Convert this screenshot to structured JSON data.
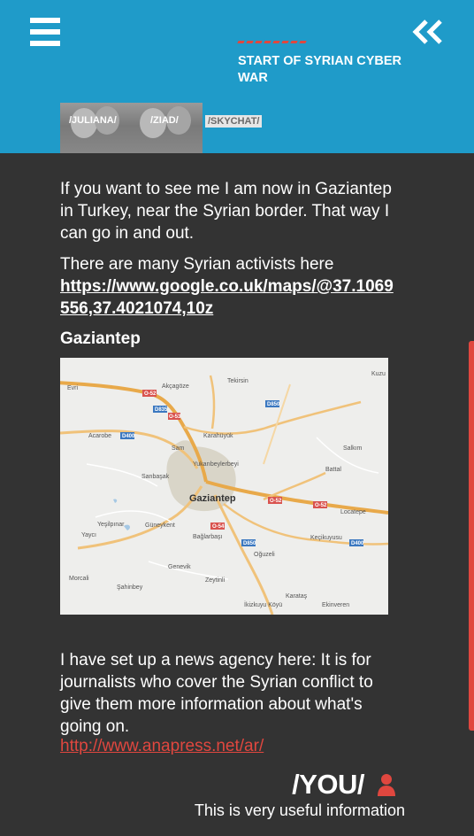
{
  "header": {
    "title": "START OF SYRIAN CYBER WAR",
    "menu_icon": "hamburger-menu-icon",
    "back_icon": "double-chevron-left-icon",
    "accent_color": "#e0473f",
    "background_color": "#1f9bc9"
  },
  "tabs": [
    {
      "label": "/JULIANA/"
    },
    {
      "label": "/ZIAD/"
    },
    {
      "label": "/SKYCHAT/",
      "active": true
    }
  ],
  "chat": {
    "messages": [
      {
        "text": "If you want to see me I am now in Gaziantep in Turkey, near the Syrian border. That way I can go in and out."
      },
      {
        "text": "There are many Syrian activists here"
      },
      {
        "link": "https://www.google.co.uk/maps/@37.1069556,37.4021074,10z"
      },
      {
        "text": "Gaziantep"
      },
      {
        "text": "I have set up a news agency here: It is for journalists who cover the Syrian conflict to give them more information about what's going on."
      },
      {
        "link": "http://www.anapress.net/ar/"
      }
    ],
    "map": {
      "center_label": "Gaziantep",
      "places": [
        "Evri",
        "Akçagöze",
        "Tekirsin",
        "Kuzu",
        "Acarobe",
        "Karahüyük",
        "Salkım",
        "Sam",
        "Yukarıbeylerbeyi",
        "Sanbaşak",
        "Battal",
        "Yeşilpınar",
        "Güneykent",
        "Locatepe",
        "Yaycı",
        "Bağlarbaşı",
        "Keçikuyusu",
        "Oğuzeli",
        "Genevik",
        "Morcali",
        "Zeytinli",
        "Şahinbey",
        "Karataş",
        "İkizkuyu Köyü",
        "Ekinveren"
      ],
      "road_signs": [
        "O-52",
        "D835",
        "O-53",
        "D400",
        "D850",
        "O-52",
        "O-52",
        "O-54",
        "D850",
        "D400"
      ]
    }
  },
  "you": {
    "label": "/YOU/",
    "icon": "user-icon",
    "message": "This is very useful information"
  }
}
